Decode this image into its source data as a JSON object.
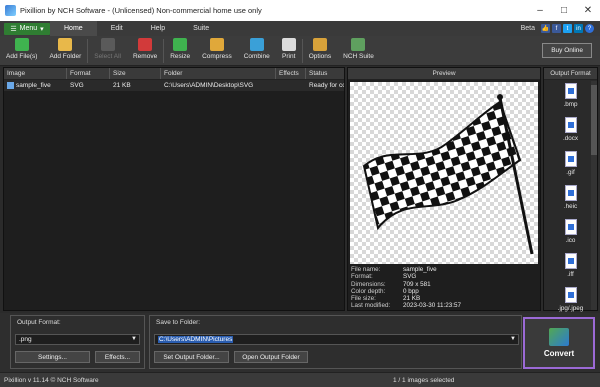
{
  "window": {
    "title": "Pixillion by NCH Software - (Unlicensed) Non-commercial home use only"
  },
  "menu": {
    "menu_button": "Menu",
    "tabs": [
      "Home",
      "Edit",
      "Help",
      "Suite"
    ],
    "beta": "Beta"
  },
  "toolbar": {
    "add_files": "Add File(s)",
    "add_folder": "Add Folder",
    "select_all": "Select All",
    "remove": "Remove",
    "resize": "Resize",
    "compress": "Compress",
    "combine": "Combine",
    "print": "Print",
    "options": "Options",
    "nch_suite": "NCH Suite",
    "buy_online": "Buy Online"
  },
  "file_list": {
    "columns": [
      "Image",
      "Format",
      "Size",
      "Folder",
      "Effects",
      "Status"
    ],
    "rows": [
      {
        "image": "sample_five",
        "format": "SVG",
        "size": "21 KB",
        "folder": "C:\\Users\\ADMIN\\Desktop\\SVG",
        "effects": "",
        "status": "Ready for co"
      }
    ]
  },
  "preview": {
    "header": "Preview",
    "info": [
      {
        "k": "File name:",
        "v": "sample_five"
      },
      {
        "k": "Format:",
        "v": "SVG"
      },
      {
        "k": "Dimensions:",
        "v": "709 x 581"
      },
      {
        "k": "Color depth:",
        "v": "0 bpp"
      },
      {
        "k": "File size:",
        "v": "21 KB"
      },
      {
        "k": "Last modified:",
        "v": "2023-03-30 11:23:57"
      }
    ]
  },
  "output_formats": {
    "header": "Output Format",
    "items": [
      ".bmp",
      ".docx",
      ".gif",
      ".heic",
      ".ico",
      ".iff",
      ".jpg/.jpeg"
    ]
  },
  "bottom": {
    "output_format_label": "Output Format:",
    "output_format_value": ".png",
    "settings": "Settings...",
    "effects": "Effects...",
    "save_folder_label": "Save to Folder:",
    "save_folder_value": "C:\\Users\\ADMIN\\Pictures",
    "set_output_folder": "Set Output Folder...",
    "open_output_folder": "Open Output Folder",
    "convert": "Convert"
  },
  "status": {
    "version": "Pixillion v 11.14 © NCH Software",
    "selection": "1 / 1 images selected"
  }
}
